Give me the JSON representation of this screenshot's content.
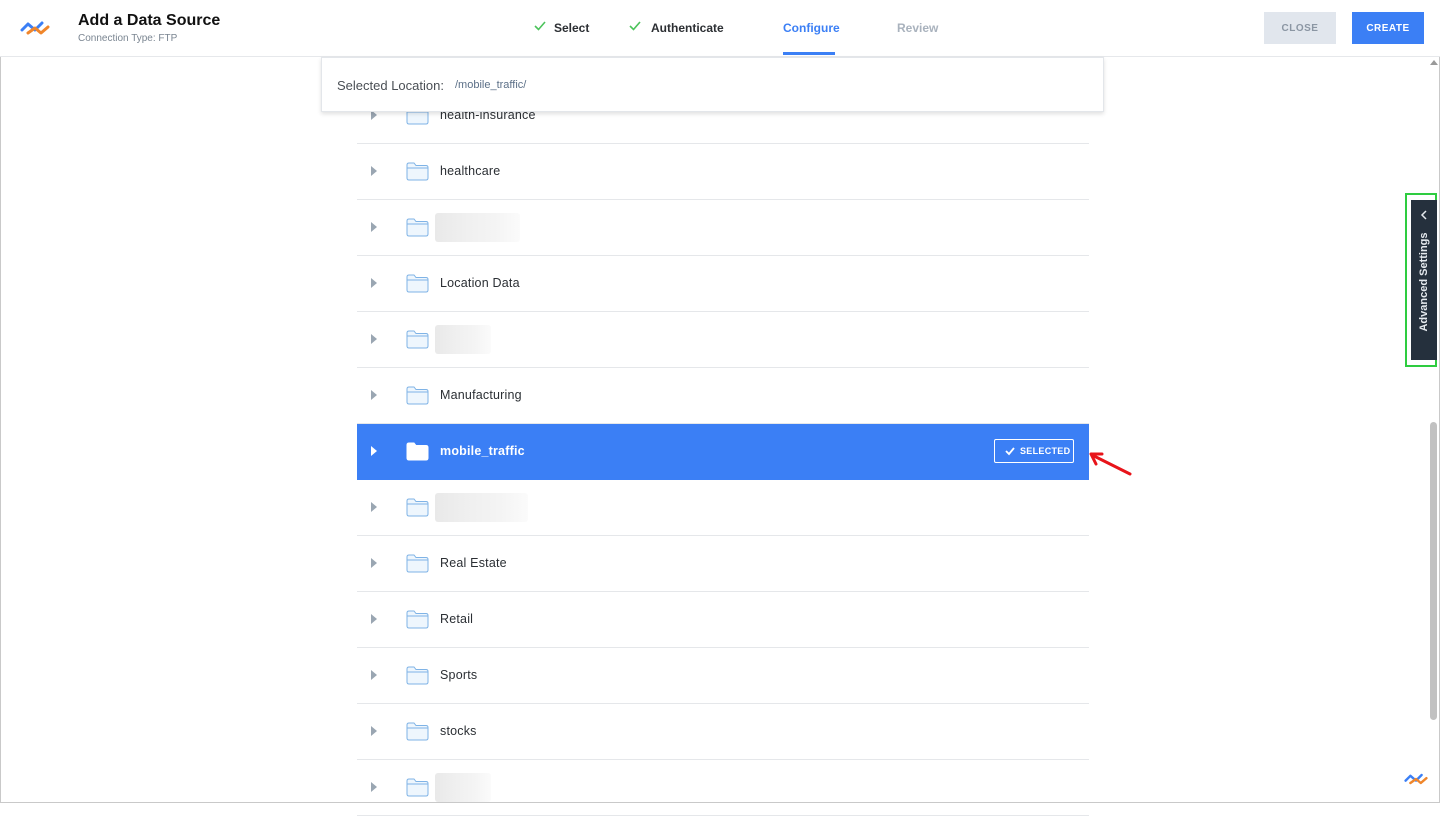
{
  "header": {
    "title": "Add a Data Source",
    "subtitle": "Connection Type: FTP",
    "close_label": "CLOSE",
    "create_label": "CREATE"
  },
  "steps": [
    {
      "label": "Select",
      "state": "done"
    },
    {
      "label": "Authenticate",
      "state": "done"
    },
    {
      "label": "Configure",
      "state": "active"
    },
    {
      "label": "Review",
      "state": "pending"
    }
  ],
  "location": {
    "label": "Selected Location:",
    "value": "/mobile_traffic/"
  },
  "folders": [
    {
      "name": "health-insurance",
      "blurred": false,
      "selected": false
    },
    {
      "name": "healthcare",
      "blurred": false,
      "selected": false
    },
    {
      "name": "",
      "blurred": true,
      "selected": false
    },
    {
      "name": "Location Data",
      "blurred": false,
      "selected": false
    },
    {
      "name": "",
      "blurred": true,
      "selected": false
    },
    {
      "name": "Manufacturing",
      "blurred": false,
      "selected": false
    },
    {
      "name": "mobile_traffic",
      "blurred": false,
      "selected": true
    },
    {
      "name": "",
      "blurred": true,
      "selected": false
    },
    {
      "name": "Real Estate",
      "blurred": false,
      "selected": false
    },
    {
      "name": "Retail",
      "blurred": false,
      "selected": false
    },
    {
      "name": "Sports",
      "blurred": false,
      "selected": false
    },
    {
      "name": "stocks",
      "blurred": false,
      "selected": false
    },
    {
      "name": "",
      "blurred": true,
      "selected": false
    }
  ],
  "selected_badge": "SELECTED",
  "advanced_settings_label": "Advanced Settings",
  "colors": {
    "accent": "#3b7ff5",
    "check": "#4cc35b",
    "sidebar_tab": "#25303d",
    "highlight_outline": "#2ecc40",
    "annotation_arrow": "#e8141a"
  },
  "icons": {
    "logo": "app-logo-icon",
    "folder": "folder-icon",
    "caret": "caret-right-icon",
    "check": "check-icon",
    "chevron": "chevron-left-icon"
  }
}
